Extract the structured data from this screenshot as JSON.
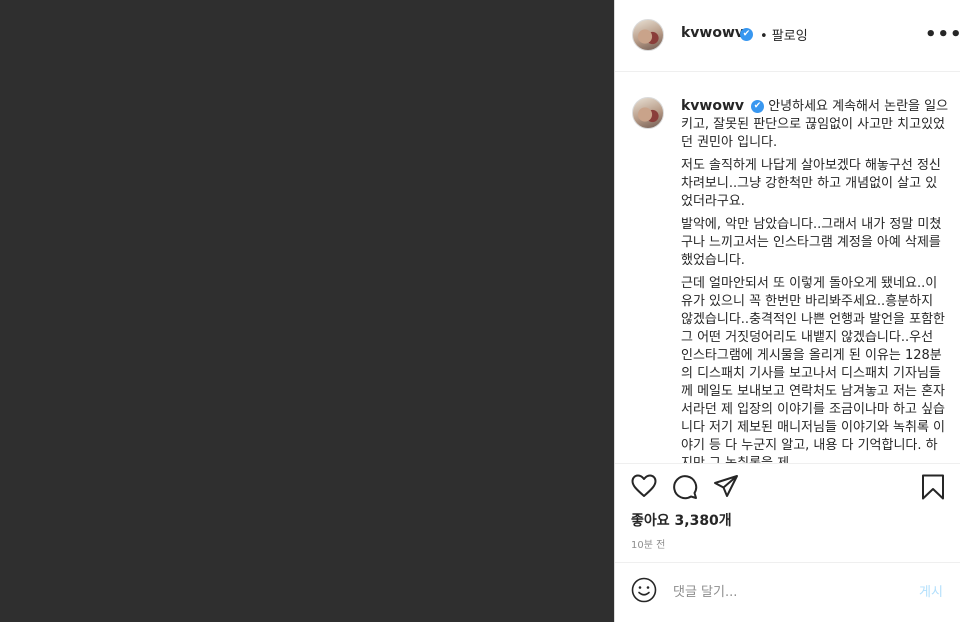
{
  "header": {
    "username": "kvwowv",
    "verified_glyph": "✔",
    "follow_label": "• 팔로잉",
    "more_label": "•••"
  },
  "caption": {
    "username": "kvwowv",
    "paragraphs": [
      "안녕하세요 계속해서 논란을 일으키고, 잘못된 판단으로 끊임없이 사고만 치고있었던 권민아 입니다.",
      "저도 솔직하게 나답게 살아보겠다 해놓구선 정신차려보니..그냥 강한척만 하고 개념없이 살고 있었더라구요.",
      "발악에, 악만 남았습니다..그래서 내가 정말 미쳤구나 느끼고서는 인스타그램 계정을 아예 삭제를 했었습니다.",
      "근데 얼마안되서 또 이렇게 돌아오게 됐네요..이유가 있으니 꼭 한번만 바리봐주세요..흥분하지 않겠습니다..충격적인 나쁜 언행과 발언을 포함한 그 어떤 거짓덩어리도 내뱉지 않겠습니다..우선 인스타그램에 게시물을 올리게 된 이유는 128분의 디스패치 기사를 보고나서 디스패치 기자님들께 메일도 보내보고 연락처도 남겨놓고 저는 혼자서라던 제 입장의 이야기를 조금이나마 하고 싶습니다 저기 제보된 매니저님들 이야기와 녹취록 이야기 등 다 누군지 알고, 내용 다 기억합니다. 하지만 그 녹취록을 제"
    ]
  },
  "icons": {
    "like": "heart-icon",
    "comment": "speech-bubble-icon",
    "share": "paper-plane-icon",
    "save": "bookmark-icon",
    "emoji": "smiley-icon"
  },
  "likes_label": "좋아요 3,380개",
  "time_label": "10분 전",
  "comment_box": {
    "placeholder": "댓글 달기...",
    "post_label": "게시"
  },
  "colors": {
    "media_bg": "#2f2f2f",
    "verified": "#3897f0",
    "post_button_disabled": "#b2dffc"
  }
}
